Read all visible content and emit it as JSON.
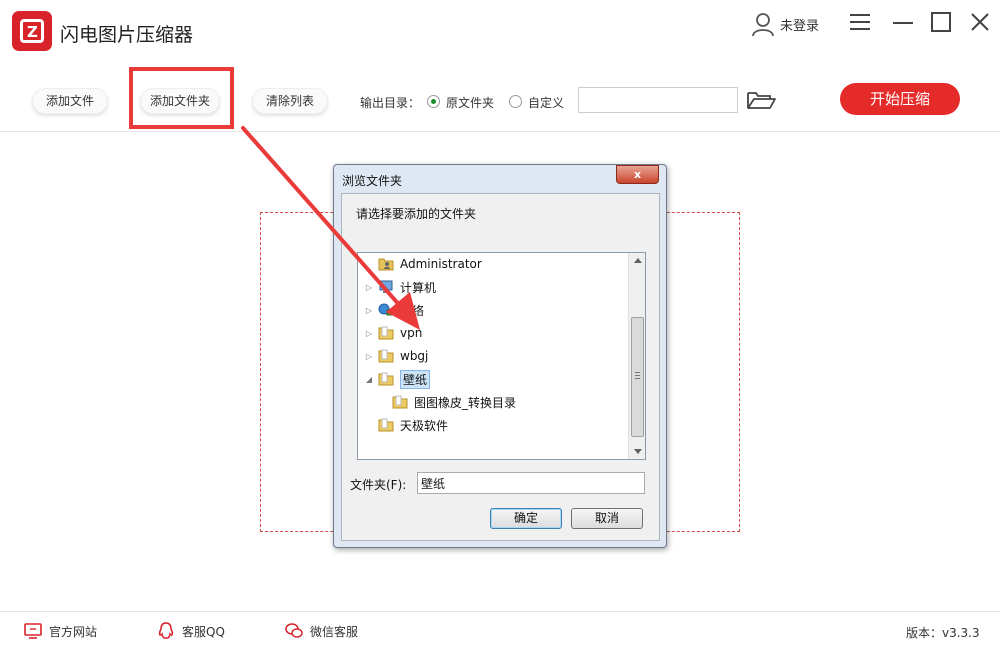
{
  "app": {
    "title": "闪电图片压缩器",
    "user_label": "未登录"
  },
  "toolbar": {
    "add_file": "添加文件",
    "add_folder": "添加文件夹",
    "clear_list": "清除列表",
    "output_label": "输出目录：",
    "option_original": "原文件夹",
    "option_custom": "自定义",
    "selected_option": "原文件夹",
    "custom_path": "",
    "start": "开始压缩"
  },
  "dialog": {
    "title": "浏览文件夹",
    "close_glyph": "x",
    "prompt": "请选择要添加的文件夹",
    "tree": [
      {
        "label": "Administrator",
        "icon": "user-folder-icon",
        "expander": ""
      },
      {
        "label": "计算机",
        "icon": "computer-icon",
        "expander": "▷"
      },
      {
        "label": "网络",
        "icon": "network-icon",
        "expander": "▷"
      },
      {
        "label": "vpn",
        "icon": "folder-icon",
        "expander": "▷"
      },
      {
        "label": "wbgj",
        "icon": "folder-icon",
        "expander": "▷"
      },
      {
        "label": "壁纸",
        "icon": "folder-icon",
        "expander": "◢",
        "selected": true
      },
      {
        "label": "图图橡皮_转换目录",
        "icon": "folder-icon",
        "expander": ""
      },
      {
        "label": "天极软件",
        "icon": "folder-icon",
        "expander": ""
      }
    ],
    "folder_label": "文件夹(F):",
    "folder_value": "壁纸",
    "ok": "确定",
    "cancel": "取消"
  },
  "footer": {
    "website": "官方网站",
    "qq": "客服QQ",
    "wechat": "微信客服",
    "version": "版本：v3.3.3"
  },
  "colors": {
    "accent": "#e52a2a",
    "annotation": "#ea3a3a",
    "radio_checked": "#1a8f2e"
  }
}
